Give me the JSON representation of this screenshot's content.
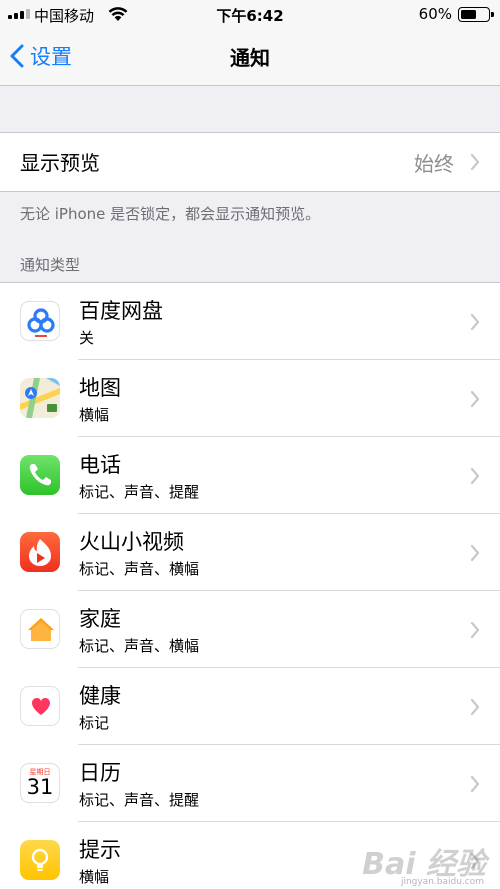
{
  "status_bar": {
    "carrier": "中国移动",
    "time": "下午6:42",
    "battery_percent_text": "60%",
    "battery_level": 0.6
  },
  "nav": {
    "back_label": "设置",
    "title": "通知"
  },
  "preview": {
    "title": "显示预览",
    "value": "始终"
  },
  "preview_footnote": "无论 iPhone 是否锁定，都会显示通知预览。",
  "section_header": "通知类型",
  "apps": [
    {
      "name": "百度网盘",
      "sub": "关",
      "icon": "baidu-netdisk-icon"
    },
    {
      "name": "地图",
      "sub": "横幅",
      "icon": "maps-icon"
    },
    {
      "name": "电话",
      "sub": "标记、声音、提醒",
      "icon": "phone-icon"
    },
    {
      "name": "火山小视频",
      "sub": "标记、声音、横幅",
      "icon": "huoshan-video-icon"
    },
    {
      "name": "家庭",
      "sub": "标记、声音、横幅",
      "icon": "home-icon"
    },
    {
      "name": "健康",
      "sub": "标记",
      "icon": "health-icon"
    },
    {
      "name": "日历",
      "sub": "标记、声音、提醒",
      "icon": "calendar-icon",
      "calendar_weekday": "星期日",
      "calendar_day": "31"
    },
    {
      "name": "提示",
      "sub": "横幅",
      "icon": "tips-icon"
    }
  ],
  "watermark": {
    "text": "Bai 经验",
    "sub": "jingyan.baidu.com"
  },
  "colors": {
    "accent": "#157efb",
    "background": "#efeff4",
    "secondary_text": "#8e8e93"
  }
}
